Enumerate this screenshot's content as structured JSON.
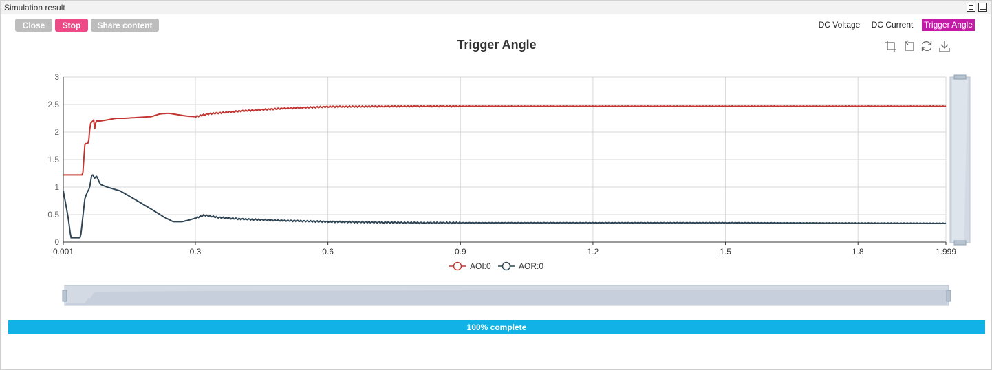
{
  "window": {
    "title": "Simulation result"
  },
  "toolbar": {
    "close_label": "Close",
    "stop_label": "Stop",
    "share_label": "Share content"
  },
  "tabs": [
    {
      "label": "DC Voltage",
      "active": false
    },
    {
      "label": "DC Current",
      "active": false
    },
    {
      "label": "Trigger Angle",
      "active": true
    }
  ],
  "chart_tools": [
    "zoom-icon",
    "zoom-reset-icon",
    "restore-icon",
    "download-icon"
  ],
  "colors": {
    "series_aoi": "#c23531",
    "series_aor": "#2f4554",
    "active_tab": "#c41aa8",
    "stop_button": "#ee4a87",
    "progress": "#11b2e6"
  },
  "progress": {
    "label": "100% complete",
    "value": 1.0
  },
  "chart_data": {
    "type": "line",
    "title": "Trigger Angle",
    "xlabel": "",
    "ylabel": "",
    "xlim": [
      0.001,
      1.999
    ],
    "ylim": [
      0,
      3
    ],
    "x_ticks": [
      "0.001",
      "0.3",
      "0.6",
      "0.9",
      "1.2",
      "1.5",
      "1.8",
      "1.999"
    ],
    "y_ticks": [
      "0",
      "0.5",
      "1",
      "1.5",
      "2",
      "2.5",
      "3"
    ],
    "grid": true,
    "legend": "bottom-center",
    "series": [
      {
        "name": "AOI:0",
        "color": "#c23531",
        "points": [
          [
            0.001,
            1.22
          ],
          [
            0.045,
            1.22
          ],
          [
            0.05,
            1.79
          ],
          [
            0.058,
            1.79
          ],
          [
            0.062,
            2.15
          ],
          [
            0.07,
            2.22
          ],
          [
            0.072,
            2.05
          ],
          [
            0.075,
            2.2
          ],
          [
            0.085,
            2.2
          ],
          [
            0.1,
            2.22
          ],
          [
            0.12,
            2.25
          ],
          [
            0.14,
            2.25
          ],
          [
            0.2,
            2.28
          ],
          [
            0.22,
            2.33
          ],
          [
            0.24,
            2.34
          ],
          [
            0.28,
            2.29
          ],
          [
            0.3,
            2.28
          ],
          [
            0.33,
            2.33
          ],
          [
            0.4,
            2.38
          ],
          [
            0.5,
            2.43
          ],
          [
            0.6,
            2.46
          ],
          [
            0.8,
            2.47
          ],
          [
            1.0,
            2.47
          ],
          [
            1.5,
            2.47
          ],
          [
            1.999,
            2.47
          ]
        ]
      },
      {
        "name": "AOR:0",
        "color": "#2f4554",
        "points": [
          [
            0.001,
            0.93
          ],
          [
            0.012,
            0.45
          ],
          [
            0.018,
            0.08
          ],
          [
            0.04,
            0.08
          ],
          [
            0.05,
            0.8
          ],
          [
            0.056,
            0.92
          ],
          [
            0.06,
            0.97
          ],
          [
            0.066,
            1.24
          ],
          [
            0.072,
            1.16
          ],
          [
            0.076,
            1.2
          ],
          [
            0.085,
            1.05
          ],
          [
            0.1,
            1.0
          ],
          [
            0.13,
            0.93
          ],
          [
            0.16,
            0.79
          ],
          [
            0.2,
            0.6
          ],
          [
            0.23,
            0.45
          ],
          [
            0.25,
            0.37
          ],
          [
            0.27,
            0.37
          ],
          [
            0.29,
            0.41
          ],
          [
            0.32,
            0.49
          ],
          [
            0.35,
            0.45
          ],
          [
            0.4,
            0.42
          ],
          [
            0.5,
            0.39
          ],
          [
            0.6,
            0.37
          ],
          [
            0.8,
            0.35
          ],
          [
            1.0,
            0.35
          ],
          [
            1.5,
            0.35
          ],
          [
            1.999,
            0.34
          ]
        ]
      }
    ]
  }
}
